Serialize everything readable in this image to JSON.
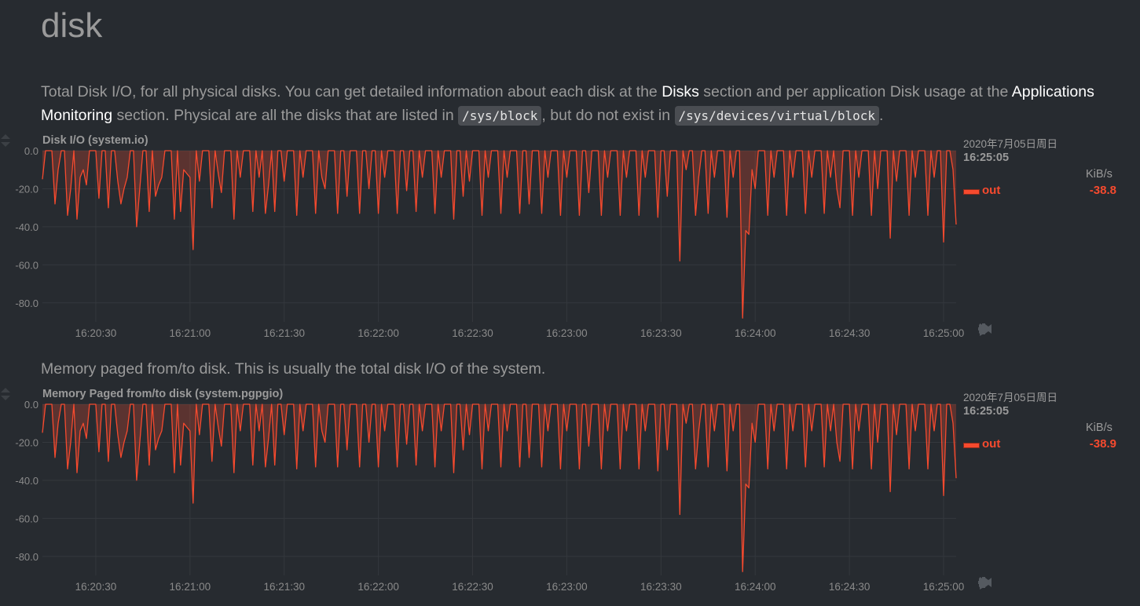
{
  "section": {
    "title": "disk"
  },
  "descriptions": {
    "disk_io": {
      "p1": "Total Disk I/O, for all physical disks. You can get detailed information about each disk at the ",
      "link1": "Disks",
      "p2": " section and per application Disk usage at the ",
      "link2": "Applications Monitoring",
      "p3": " section. Physical are all the disks that are listed in ",
      "code1": "/sys/block",
      "p4": ", but do not exist in ",
      "code2": "/sys/devices/virtual/block",
      "p5": "."
    },
    "paged": "Memory paged from/to disk. This is usually the total disk I/O of the system."
  },
  "colors": {
    "series": "#f64a2e",
    "background": "#272b30",
    "grid": "#34383d"
  },
  "icons": [
    "rewind-icon",
    "play-icon",
    "fast-forward-icon",
    "zoom-in-icon",
    "zoom-out-icon",
    "resize-handle-icon"
  ],
  "charts": [
    {
      "title": "Disk I/O (system.io)",
      "date": "2020年7月05日周日",
      "time": "16:25:05",
      "units": "KiB/s",
      "legend": {
        "name": "out",
        "value": "-38.8"
      }
    },
    {
      "title": "Memory Paged from/to disk (system.pgpgio)",
      "date": "2020年7月05日周日",
      "time": "16:25:05",
      "units": "KiB/s",
      "legend": {
        "name": "out",
        "value": "-38.9"
      }
    }
  ],
  "chart_data": [
    {
      "type": "area",
      "title": "Disk I/O (system.io)",
      "ylabel": "KiB/s",
      "ylim": [
        -90,
        0
      ],
      "y_ticks": [
        "0.0",
        "-20.0",
        "-40.0",
        "-60.0",
        "-80.0"
      ],
      "x_ticks": [
        "16:20:30",
        "16:21:00",
        "16:21:30",
        "16:22:00",
        "16:22:30",
        "16:23:00",
        "16:23:30",
        "16:24:00",
        "16:24:30",
        "16:25:00"
      ],
      "grid": true,
      "series": [
        {
          "name": "out",
          "color": "#f64a2e",
          "x_start": "16:20:13",
          "x_end": "16:25:05",
          "x_step_seconds": 1,
          "values": [
            -15,
            0,
            0,
            0,
            -28,
            -10,
            0,
            0,
            -34,
            -20,
            0,
            -36,
            -14,
            -10,
            -18,
            0,
            0,
            0,
            -25,
            0,
            0,
            -30,
            0,
            0,
            -16,
            -28,
            -20,
            -14,
            0,
            0,
            -40,
            -20,
            0,
            0,
            -32,
            0,
            -24,
            -18,
            -14,
            0,
            0,
            0,
            -36,
            0,
            -32,
            -10,
            -12,
            -14,
            -52,
            0,
            -16,
            0,
            0,
            0,
            -30,
            0,
            -12,
            -22,
            0,
            0,
            0,
            -36,
            0,
            -14,
            0,
            0,
            0,
            -32,
            0,
            -14,
            0,
            -33,
            -18,
            0,
            -32,
            0,
            0,
            -16,
            0,
            0,
            0,
            -34,
            0,
            -14,
            0,
            0,
            0,
            -33,
            0,
            -14,
            -20,
            0,
            0,
            0,
            -33,
            0,
            0,
            -24,
            0,
            0,
            0,
            -33,
            0,
            0,
            -20,
            0,
            0,
            -33,
            0,
            -14,
            0,
            0,
            0,
            -33,
            0,
            0,
            -21,
            0,
            0,
            -32,
            0,
            -14,
            0,
            0,
            0,
            -33,
            0,
            -14,
            0,
            0,
            0,
            -36,
            0,
            0,
            -24,
            0,
            -16,
            0,
            0,
            0,
            -34,
            0,
            -14,
            0,
            0,
            0,
            -33,
            0,
            -14,
            0,
            0,
            0,
            -33,
            0,
            0,
            -28,
            0,
            0,
            0,
            -33,
            0,
            -14,
            0,
            0,
            0,
            -34,
            0,
            -14,
            0,
            0,
            0,
            -34,
            0,
            0,
            -22,
            0,
            0,
            0,
            -34,
            0,
            -14,
            0,
            0,
            0,
            -34,
            0,
            -14,
            0,
            0,
            0,
            -34,
            0,
            -14,
            0,
            0,
            0,
            -35,
            0,
            0,
            -24,
            0,
            0,
            0,
            -58,
            0,
            -10,
            0,
            0,
            -34,
            -14,
            0,
            0,
            -33,
            0,
            -14,
            0,
            0,
            0,
            -35,
            0,
            -14,
            0,
            0,
            -88,
            -42,
            -44,
            -10,
            -20,
            0,
            0,
            0,
            -34,
            0,
            -14,
            0,
            0,
            0,
            -34,
            0,
            -14,
            0,
            0,
            0,
            -33,
            0,
            -14,
            0,
            0,
            0,
            -33,
            0,
            -14,
            0,
            -20,
            -30,
            0,
            0,
            0,
            -34,
            0,
            -14,
            0,
            0,
            0,
            -34,
            0,
            -20,
            0,
            0,
            0,
            -46,
            0,
            -16,
            0,
            0,
            0,
            -34,
            0,
            -14,
            0,
            0,
            0,
            -34,
            0,
            -14,
            0,
            0,
            -48,
            0,
            0,
            -10,
            -38.8
          ]
        }
      ]
    },
    {
      "type": "area",
      "title": "Memory Paged from/to disk (system.pgpgio)",
      "ylabel": "KiB/s",
      "ylim": [
        -90,
        0
      ],
      "y_ticks": [
        "0.0",
        "-20.0",
        "-40.0",
        "-60.0",
        "-80.0"
      ],
      "x_ticks": [
        "16:20:30",
        "16:21:00",
        "16:21:30",
        "16:22:00",
        "16:22:30",
        "16:23:00",
        "16:23:30",
        "16:24:00",
        "16:24:30",
        "16:25:00"
      ],
      "grid": true,
      "series": [
        {
          "name": "out",
          "color": "#f64a2e",
          "x_start": "16:20:13",
          "x_end": "16:25:05",
          "x_step_seconds": 1,
          "values": [
            -15,
            0,
            0,
            0,
            -28,
            -10,
            0,
            0,
            -34,
            -20,
            0,
            -36,
            -14,
            -10,
            -18,
            0,
            0,
            0,
            -25,
            0,
            0,
            -30,
            0,
            0,
            -16,
            -28,
            -20,
            -14,
            0,
            0,
            -40,
            -20,
            0,
            0,
            -32,
            0,
            -24,
            -18,
            -14,
            0,
            0,
            0,
            -36,
            0,
            -32,
            -10,
            -12,
            -14,
            -52,
            0,
            -16,
            0,
            0,
            0,
            -30,
            0,
            -12,
            -22,
            0,
            0,
            0,
            -36,
            0,
            -14,
            0,
            0,
            0,
            -32,
            0,
            -14,
            0,
            -33,
            -18,
            0,
            -32,
            0,
            0,
            -16,
            0,
            0,
            0,
            -34,
            0,
            -14,
            0,
            0,
            0,
            -33,
            0,
            -14,
            -20,
            0,
            0,
            0,
            -33,
            0,
            0,
            -24,
            0,
            0,
            0,
            -33,
            0,
            0,
            -20,
            0,
            0,
            -33,
            0,
            -14,
            0,
            0,
            0,
            -33,
            0,
            0,
            -21,
            0,
            0,
            -32,
            0,
            -14,
            0,
            0,
            0,
            -33,
            0,
            -14,
            0,
            0,
            0,
            -36,
            0,
            0,
            -24,
            0,
            -16,
            0,
            0,
            0,
            -34,
            0,
            -14,
            0,
            0,
            0,
            -33,
            0,
            -14,
            0,
            0,
            0,
            -33,
            0,
            0,
            -28,
            0,
            0,
            0,
            -33,
            0,
            -14,
            0,
            0,
            0,
            -34,
            0,
            -14,
            0,
            0,
            0,
            -34,
            0,
            0,
            -22,
            0,
            0,
            0,
            -34,
            0,
            -14,
            0,
            0,
            0,
            -34,
            0,
            -14,
            0,
            0,
            0,
            -34,
            0,
            -14,
            0,
            0,
            0,
            -35,
            0,
            0,
            -24,
            0,
            0,
            0,
            -58,
            0,
            -10,
            0,
            0,
            -34,
            -14,
            0,
            0,
            -33,
            0,
            -14,
            0,
            0,
            0,
            -35,
            0,
            -14,
            0,
            0,
            -88,
            -42,
            -44,
            -10,
            -20,
            0,
            0,
            0,
            -34,
            0,
            -14,
            0,
            0,
            0,
            -34,
            0,
            -14,
            0,
            0,
            0,
            -33,
            0,
            -14,
            0,
            0,
            0,
            -33,
            0,
            -14,
            0,
            -20,
            -30,
            0,
            0,
            0,
            -34,
            0,
            -14,
            0,
            0,
            0,
            -34,
            0,
            -20,
            0,
            0,
            0,
            -46,
            0,
            -16,
            0,
            0,
            0,
            -34,
            0,
            -14,
            0,
            0,
            0,
            -34,
            0,
            -14,
            0,
            0,
            -48,
            0,
            0,
            -10,
            -38.9
          ]
        }
      ]
    }
  ]
}
